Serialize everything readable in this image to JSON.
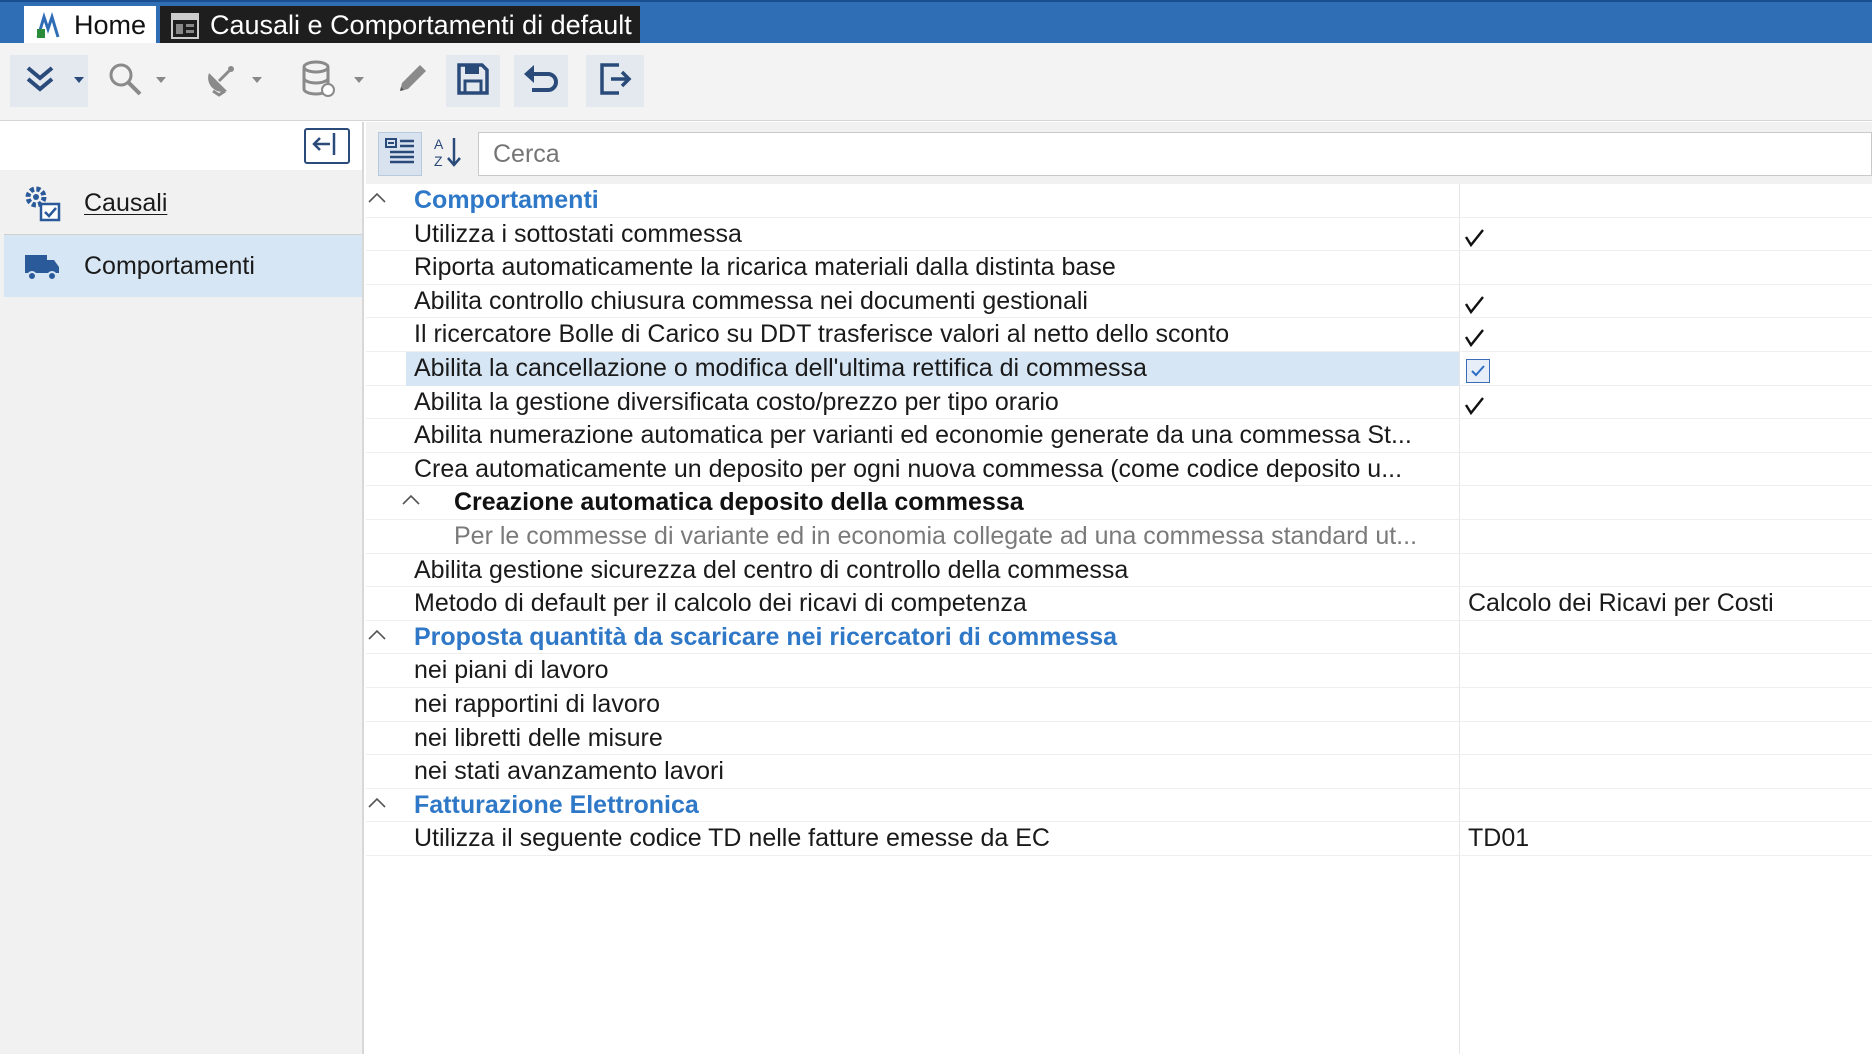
{
  "titlebar": {
    "tabs": [
      {
        "label": "Home",
        "icon": "app-logo-icon"
      },
      {
        "label": "Causali e Comportamenti di default",
        "icon": "window-form-icon"
      }
    ]
  },
  "toolbar": {
    "buttons": [
      {
        "name": "expand-all",
        "icon": "double-chevron-down-icon"
      },
      {
        "name": "search",
        "icon": "magnifier-icon"
      },
      {
        "name": "tools",
        "icon": "satellite-dish-icon"
      },
      {
        "name": "database",
        "icon": "database-icon"
      },
      {
        "name": "edit",
        "icon": "pencil-icon"
      },
      {
        "name": "save",
        "icon": "floppy-icon"
      },
      {
        "name": "undo",
        "icon": "undo-arrow-icon"
      },
      {
        "name": "exit",
        "icon": "exit-door-icon"
      }
    ]
  },
  "sidebar": {
    "items": [
      {
        "label": "Causali",
        "icon": "gears-icon"
      },
      {
        "label": "Comportamenti",
        "icon": "truck-icon"
      }
    ]
  },
  "panel": {
    "search_placeholder": "Cerca",
    "rows": [
      {
        "type": "category",
        "label": "Comportamenti"
      },
      {
        "type": "prop",
        "label": "Utilizza i sottostati commessa",
        "check": true
      },
      {
        "type": "prop",
        "label": "Riporta automaticamente la ricarica materiali dalla distinta base",
        "check": false
      },
      {
        "type": "prop",
        "label": "Abilita controllo chiusura commessa nei documenti gestionali",
        "check": true
      },
      {
        "type": "prop",
        "label": "Il ricercatore Bolle di Carico su DDT trasferisce valori al netto dello sconto",
        "check": true
      },
      {
        "type": "prop",
        "label": "Abilita la cancellazione o modifica dell'ultima rettifica di commessa",
        "checkbox": true
      },
      {
        "type": "prop",
        "label": "Abilita la gestione diversificata costo/prezzo per tipo orario",
        "check": true
      },
      {
        "type": "prop",
        "label": "Abilita numerazione automatica per varianti ed economie generate da una commessa St...",
        "check": false
      },
      {
        "type": "prop",
        "label": "Crea automaticamente un deposito per ogni nuova commessa (come codice deposito u...",
        "check": false
      },
      {
        "type": "subcategory",
        "label": "Creazione automatica deposito della commessa"
      },
      {
        "type": "desc",
        "label": "Per le commesse di variante ed in economia collegate ad una commessa standard ut..."
      },
      {
        "type": "prop",
        "label": "Abilita gestione sicurezza del centro di controllo della commessa",
        "check": false
      },
      {
        "type": "prop",
        "label": "Metodo di default per il calcolo dei ricavi di competenza",
        "value": "Calcolo dei Ricavi per Costi"
      },
      {
        "type": "category",
        "label": "Proposta quantità da scaricare nei ricercatori di commessa"
      },
      {
        "type": "prop",
        "label": "nei piani di lavoro"
      },
      {
        "type": "prop",
        "label": "nei rapportini di lavoro"
      },
      {
        "type": "prop",
        "label": "nei libretti delle misure"
      },
      {
        "type": "prop",
        "label": "nei stati avanzamento lavori"
      },
      {
        "type": "category",
        "label": "Fatturazione Elettronica"
      },
      {
        "type": "prop",
        "label": "Utilizza il seguente codice TD nelle fatture emesse da EC",
        "value": "TD01"
      }
    ]
  },
  "colors": {
    "titlebar": "#2f6db5",
    "category_text": "#2e78c7",
    "selection": "#d7e6f4",
    "icon_dark": "#2a4a7a"
  }
}
